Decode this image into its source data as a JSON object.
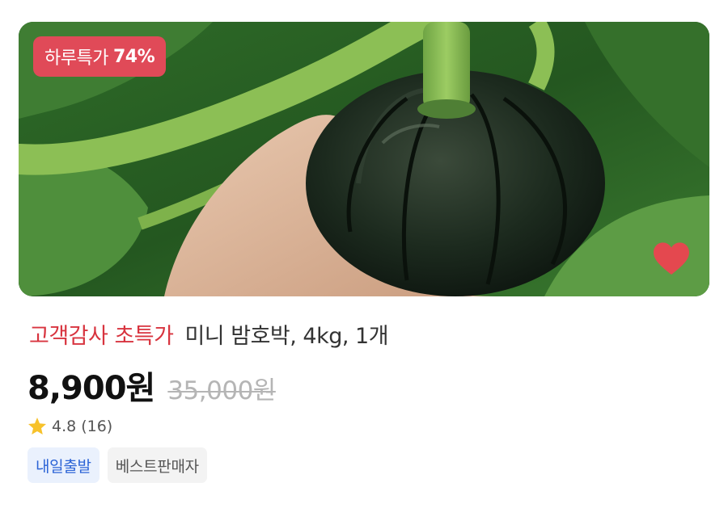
{
  "product": {
    "badge_label": "하루특가",
    "badge_discount": "74%",
    "promo_label": "고객감사 초특가",
    "name": "미니 밤호박, 4kg, 1개",
    "sale_price": "8,900원",
    "original_price": "35,000원",
    "rating": "4.8",
    "review_count": "(16)",
    "tags": [
      "내일출발",
      "베스트판매자"
    ],
    "wishlist_icon": "heart-icon",
    "rating_icon": "star-icon"
  },
  "colors": {
    "badge_bg": "#e04a58",
    "promo_text": "#d8343f",
    "heart": "#e4484f",
    "star": "#f7c22b",
    "delivery_tag_text": "#2c64d6"
  }
}
